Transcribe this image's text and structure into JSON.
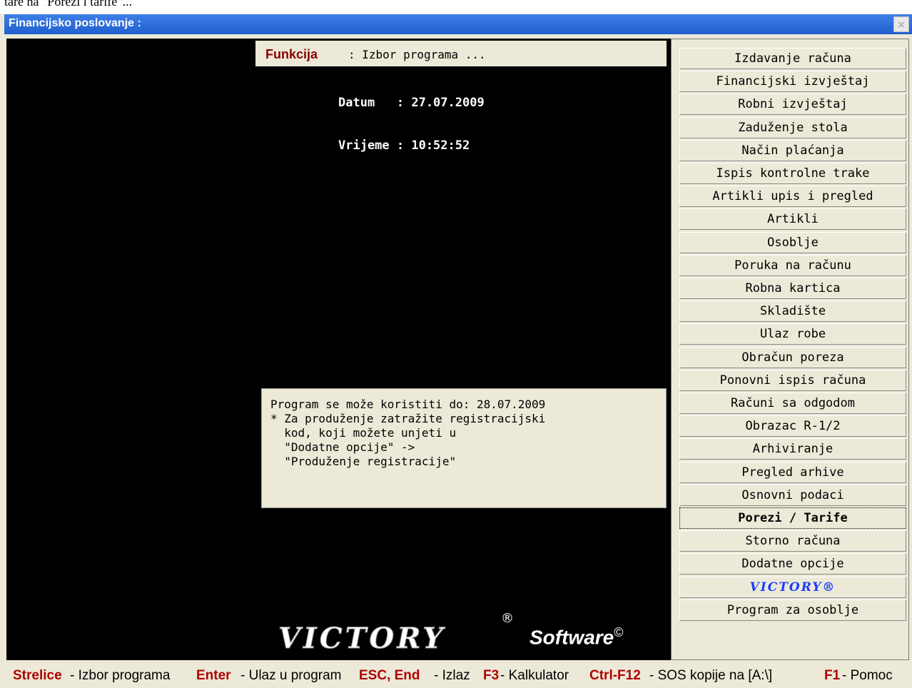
{
  "top_strip_text": "tare na \"Porezi i tarife\"...",
  "window": {
    "title": "Financijsko poslovanje :",
    "close_label": "×"
  },
  "function_bar": {
    "label": "Funkcija",
    "value": ": Izbor programa ..."
  },
  "datetime": {
    "date_line": "Datum   : 27.07.2009",
    "time_line": "Vrijeme : 10:52:52"
  },
  "notice": {
    "line1": "Program se može koristiti do: 28.07.2009",
    "line2": "* Za produženje zatražite registracijski",
    "line3": "  kod, koji možete unjeti u",
    "line4": "  \"Dodatne opcije\" ->",
    "line5": "  \"Produženje registracije\""
  },
  "brand": {
    "logo": "VICTORY",
    "reg_mark": "®",
    "software": "Software",
    "copyright": "©"
  },
  "menu": {
    "items": [
      "Izdavanje računa",
      "Financijski izvještaj",
      "Robni izvještaj",
      "Zaduženje stola",
      "Način plaćanja",
      "Ispis kontrolne trake",
      "Artikli upis i pregled",
      "Artikli",
      "Osoblje",
      "Poruka na računu",
      "Robna kartica",
      "Skladište",
      "Ulaz robe",
      "Obračun poreza",
      "Ponovni ispis računa",
      "Računi sa odgodom",
      "Obrazac R-1/2",
      "Arhiviranje",
      "Pregled arhive",
      "Osnovni podaci",
      "Porezi / Tarife",
      "Storno računa",
      "Dodatne opcije",
      "VICTORY®",
      "Program za osoblje"
    ],
    "selected": "Porezi / Tarife"
  },
  "statusbar": {
    "k1": "Strelice",
    "t1": "- Izbor programa",
    "k2": "Enter",
    "t2": "- Ulaz u program",
    "k3": "ESC, End",
    "t3": "- Izlaz",
    "k4": "F3",
    "t4": "- Kalkulator",
    "k5": "Ctrl-F12",
    "t5": "- SOS kopije na [A:\\]",
    "k6": "F1",
    "t6": "- Pomoc"
  }
}
